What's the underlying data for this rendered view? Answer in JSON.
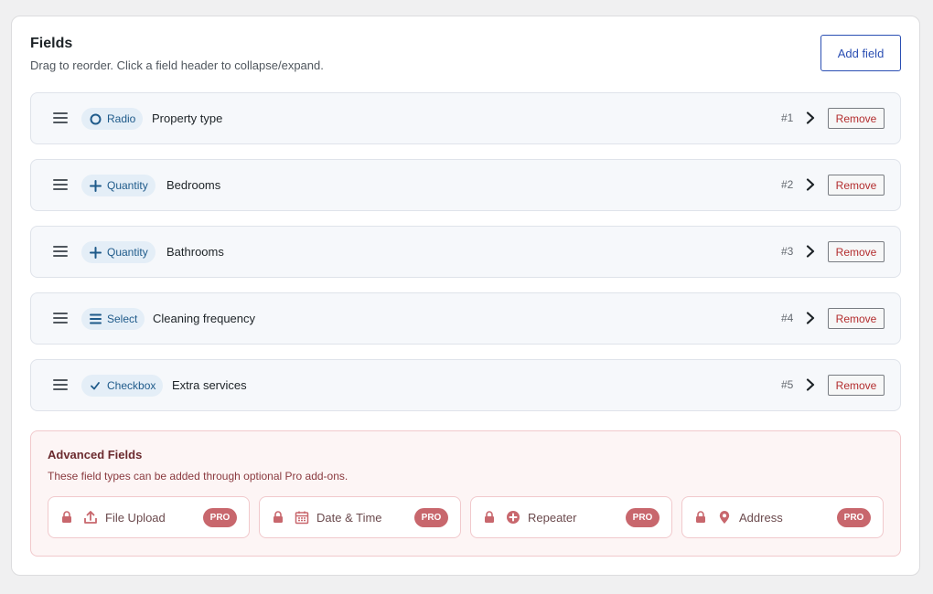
{
  "header": {
    "title": "Fields",
    "subtitle": "Drag to reorder. Click a field header to collapse/expand.",
    "add_label": "Add field"
  },
  "fields": [
    {
      "type": "Radio",
      "icon": "radio-icon",
      "label": "Property type",
      "num": "#1",
      "remove": "Remove"
    },
    {
      "type": "Quantity",
      "icon": "plus-icon",
      "label": "Bedrooms",
      "num": "#2",
      "remove": "Remove"
    },
    {
      "type": "Quantity",
      "icon": "plus-icon",
      "label": "Bathrooms",
      "num": "#3",
      "remove": "Remove"
    },
    {
      "type": "Select",
      "icon": "list-icon",
      "label": "Cleaning frequency",
      "num": "#4",
      "remove": "Remove"
    },
    {
      "type": "Checkbox",
      "icon": "checkmark-icon",
      "label": "Extra services",
      "num": "#5",
      "remove": "Remove"
    }
  ],
  "advanced": {
    "title": "Advanced Fields",
    "subtitle": "These field types can be added through optional Pro add-ons.",
    "items": [
      {
        "label": "File Upload",
        "icon": "upload-icon",
        "badge": "PRO"
      },
      {
        "label": "Date & Time",
        "icon": "calendar-icon",
        "badge": "PRO"
      },
      {
        "label": "Repeater",
        "icon": "plus-circle-icon",
        "badge": "PRO"
      },
      {
        "label": "Address",
        "icon": "map-pin-icon",
        "badge": "PRO"
      }
    ]
  },
  "colors": {
    "accent": "#2b4fb3",
    "badge_bg": "#e4eef7",
    "badge_text": "#1e5a8a",
    "remove_text": "#b32d2e",
    "pro_badge": "#c8676d",
    "advanced_bg": "#fdf5f5"
  }
}
